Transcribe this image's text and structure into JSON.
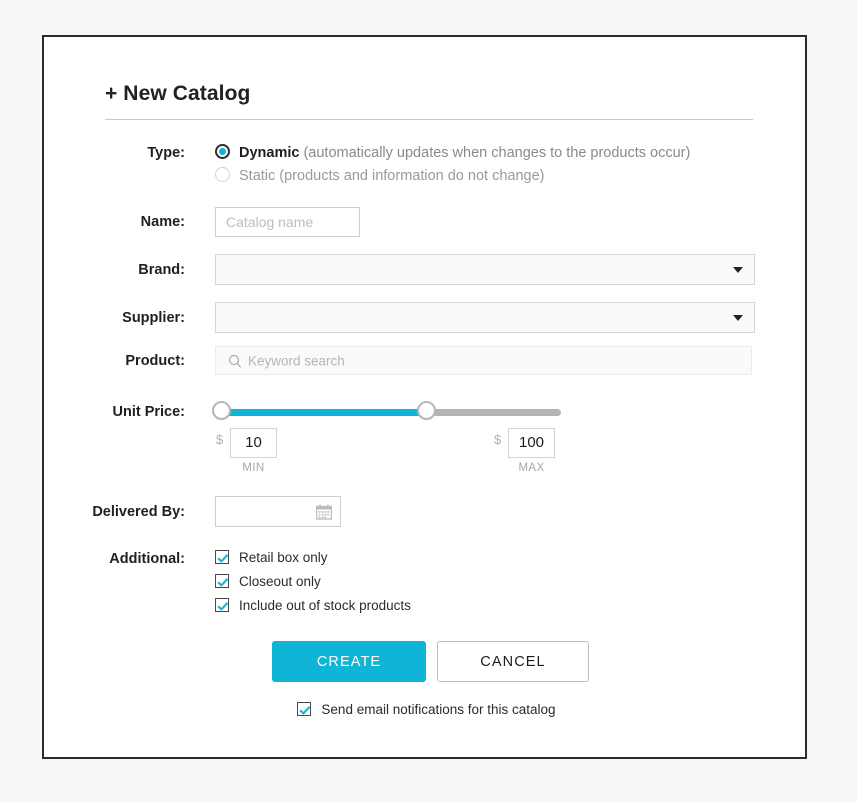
{
  "form": {
    "title": "+ New Catalog",
    "type": {
      "label": "Type:",
      "options": [
        {
          "value": "dynamic",
          "strong": "Dynamic",
          "note": "(automatically updates when changes to the products occur)",
          "selected": true
        },
        {
          "value": "static",
          "text": "Static (products and information do not change)",
          "selected": false
        }
      ]
    },
    "name": {
      "label": "Name:",
      "value": "",
      "placeholder": "Catalog name"
    },
    "brand": {
      "label": "Brand:",
      "value": "",
      "caret_icon": "chevron-down-icon"
    },
    "supplier": {
      "label": "Supplier:",
      "value": "",
      "caret_icon": "chevron-down-icon"
    },
    "product": {
      "label": "Product:",
      "value": "",
      "placeholder": "Keyword search",
      "icon": "search-icon"
    },
    "unit_price": {
      "label": "Unit Price:",
      "min_value": "10",
      "max_value": "100",
      "min_caption": "MIN",
      "max_caption": "MAX",
      "currency": "$",
      "slider": {
        "left_percent": 2,
        "right_percent": 61
      }
    },
    "delivered_by": {
      "label": "Delivered By:",
      "value": "",
      "icon": "calendar-icon"
    },
    "additional": {
      "label": "Additional:",
      "items": [
        {
          "label": "Retail box only",
          "checked": true
        },
        {
          "label": "Closeout only",
          "checked": true
        },
        {
          "label": "Include out of stock products",
          "checked": true
        }
      ]
    },
    "actions": {
      "create": "CREATE",
      "cancel": "CANCEL"
    },
    "email_notice": {
      "label": "Send email notifications for this catalog",
      "checked": true
    }
  },
  "colors": {
    "accent": "#0fb5d6",
    "track": "#b5b5b5",
    "card_border": "#2b2b2b",
    "page_bg": "#f7f7f7",
    "muted_text": "#8a8a8a"
  }
}
